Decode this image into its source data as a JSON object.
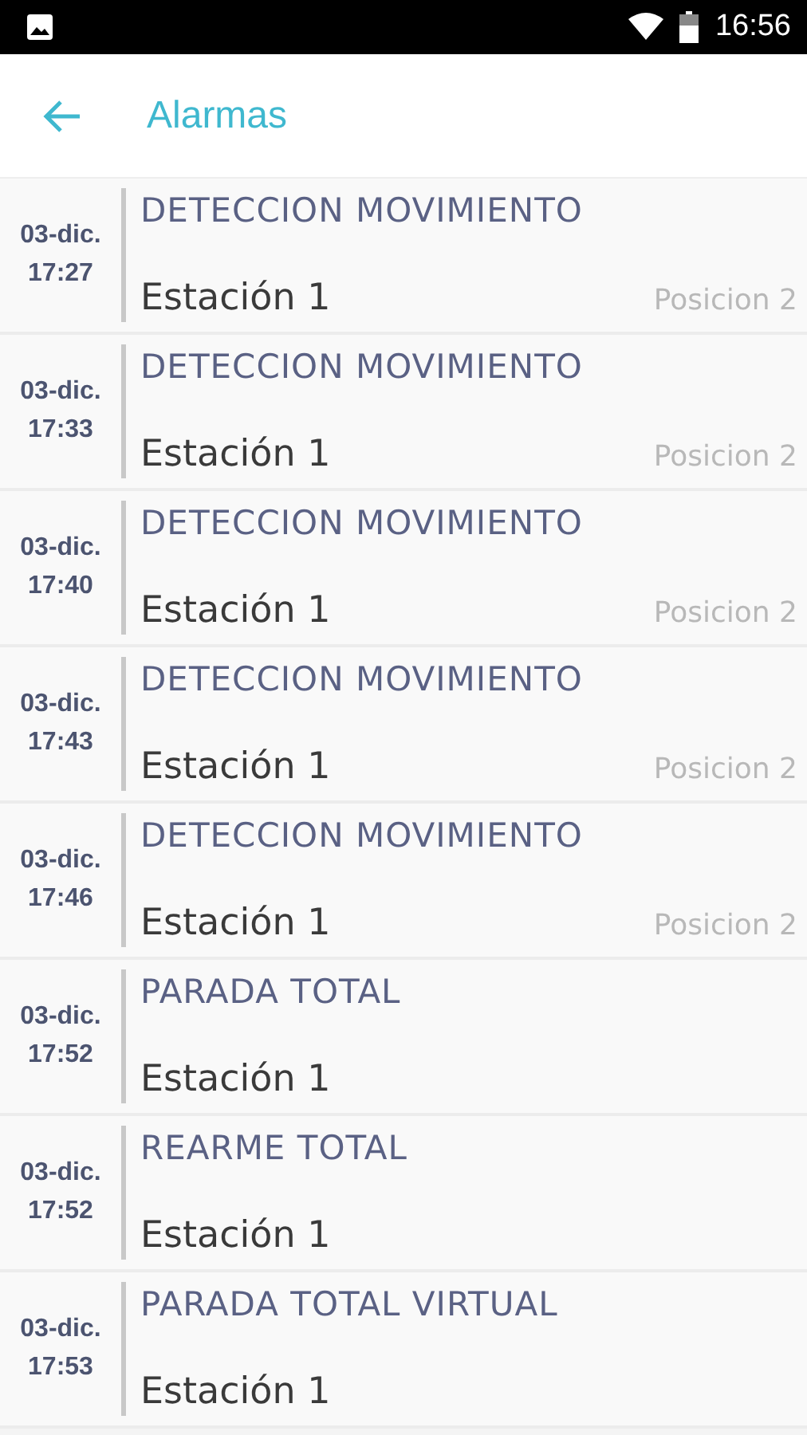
{
  "status_bar": {
    "time": "16:56"
  },
  "header": {
    "title": "Alarmas"
  },
  "alarms": [
    {
      "date": "03-dic.",
      "time": "17:27",
      "title": "DETECCION MOVIMIENTO",
      "station": "Estación 1",
      "position": "Posicion 2"
    },
    {
      "date": "03-dic.",
      "time": "17:33",
      "title": "DETECCION MOVIMIENTO",
      "station": "Estación 1",
      "position": "Posicion 2"
    },
    {
      "date": "03-dic.",
      "time": "17:40",
      "title": "DETECCION MOVIMIENTO",
      "station": "Estación 1",
      "position": "Posicion 2"
    },
    {
      "date": "03-dic.",
      "time": "17:43",
      "title": "DETECCION MOVIMIENTO",
      "station": "Estación 1",
      "position": "Posicion 2"
    },
    {
      "date": "03-dic.",
      "time": "17:46",
      "title": "DETECCION MOVIMIENTO",
      "station": "Estación 1",
      "position": "Posicion 2"
    },
    {
      "date": "03-dic.",
      "time": "17:52",
      "title": "PARADA TOTAL",
      "station": "Estación 1"
    },
    {
      "date": "03-dic.",
      "time": "17:52",
      "title": "REARME TOTAL",
      "station": "Estación 1"
    },
    {
      "date": "03-dic.",
      "time": "17:53",
      "title": "PARADA TOTAL VIRTUAL",
      "station": "Estación 1"
    }
  ]
}
